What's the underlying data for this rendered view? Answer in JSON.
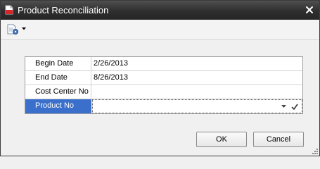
{
  "window": {
    "title": "Product Reconciliation",
    "app_icon": "document-app-icon",
    "close_icon": "close-icon"
  },
  "toolbar": {
    "icon": "document-settings-icon",
    "dropdown_icon": "chevron-down-icon"
  },
  "grid": {
    "rows": [
      {
        "label": "Begin Date",
        "value": "2/26/2013"
      },
      {
        "label": "End Date",
        "value": "8/26/2013"
      },
      {
        "label": "Cost Center No",
        "value": ""
      },
      {
        "label": "Product No",
        "value": ""
      }
    ],
    "selected_row": "Product No",
    "editor_icons": [
      "chevron-down-icon",
      "check-icon"
    ]
  },
  "buttons": {
    "ok_label": "OK",
    "cancel_label": "Cancel"
  },
  "colors": {
    "titlebar": "#2e2e2e",
    "selection": "#3a6fcb",
    "background": "#f0f0f0"
  }
}
